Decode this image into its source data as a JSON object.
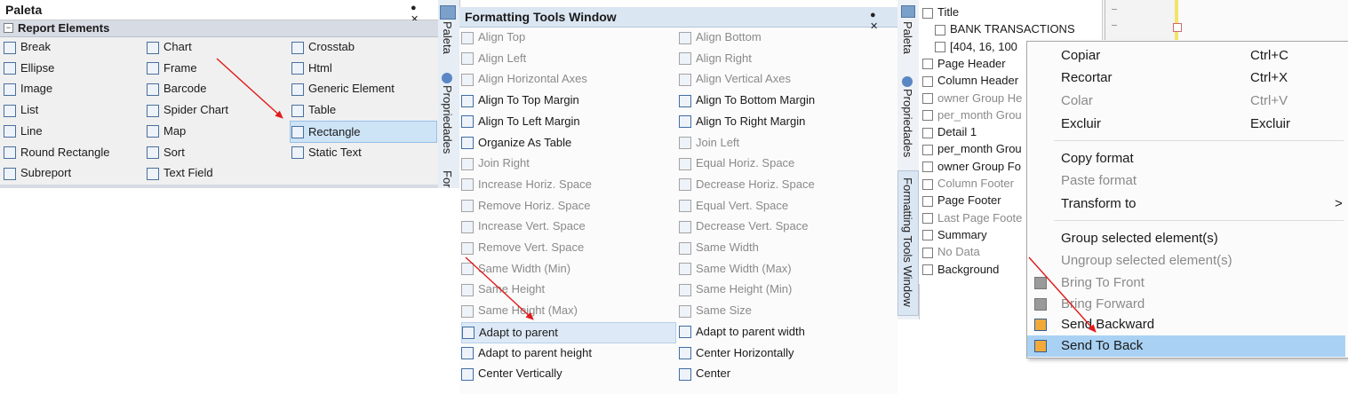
{
  "palette": {
    "title": "Paleta",
    "category": "Report Elements",
    "col1": [
      {
        "label": "Break",
        "icon": "break-icon"
      },
      {
        "label": "Ellipse",
        "icon": "ellipse-icon"
      },
      {
        "label": "Image",
        "icon": "image-icon"
      },
      {
        "label": "List",
        "icon": "list-icon"
      },
      {
        "label": "Line",
        "icon": "line-icon"
      },
      {
        "label": "Round Rectangle",
        "icon": "round-rectangle-icon"
      },
      {
        "label": "Subreport",
        "icon": "subreport-icon"
      }
    ],
    "col2": [
      {
        "label": "Chart",
        "icon": "chart-icon"
      },
      {
        "label": "Frame",
        "icon": "frame-icon"
      },
      {
        "label": "Barcode",
        "icon": "barcode-icon"
      },
      {
        "label": "Spider Chart",
        "icon": "spider-chart-icon"
      },
      {
        "label": "Map",
        "icon": "map-pin-icon"
      },
      {
        "label": "Sort",
        "icon": "sort-icon"
      },
      {
        "label": "Text Field",
        "icon": "text-field-icon"
      }
    ],
    "col3": [
      {
        "label": "Crosstab",
        "icon": "crosstab-icon"
      },
      {
        "label": "Html",
        "icon": "html-icon"
      },
      {
        "label": "Generic Element",
        "icon": "generic-element-icon"
      },
      {
        "label": "Table",
        "icon": "table-icon"
      },
      {
        "label": "Rectangle",
        "icon": "rectangle-icon",
        "selected": true
      },
      {
        "label": "Static Text",
        "icon": "static-text-icon"
      }
    ]
  },
  "side_tabs_1": {
    "paleta": "Paleta",
    "propriedades": "Propriedades",
    "formatting": "For"
  },
  "side_tabs_2": {
    "paleta": "Paleta",
    "propriedades": "Propriedades",
    "formatting": "Formatting Tools Window"
  },
  "formatting": {
    "title": "Formatting Tools Window",
    "left": [
      {
        "label": "Align Top",
        "enabled": false
      },
      {
        "label": "Align Left",
        "enabled": false
      },
      {
        "label": "Align Horizontal Axes",
        "enabled": false
      },
      {
        "label": "Align To Top Margin",
        "enabled": true
      },
      {
        "label": "Align To Left Margin",
        "enabled": true
      },
      {
        "label": "Organize As Table",
        "enabled": true
      },
      {
        "label": "Join Right",
        "enabled": false
      },
      {
        "label": "Increase Horiz. Space",
        "enabled": false
      },
      {
        "label": "Remove Horiz. Space",
        "enabled": false
      },
      {
        "label": "Increase Vert. Space",
        "enabled": false
      },
      {
        "label": "Remove Vert. Space",
        "enabled": false
      },
      {
        "label": "Same Width (Min)",
        "enabled": false
      },
      {
        "label": "Same Height",
        "enabled": false
      },
      {
        "label": "Same Height (Max)",
        "enabled": false
      },
      {
        "label": "Adapt to parent",
        "enabled": true,
        "selected": true
      },
      {
        "label": "Adapt to parent height",
        "enabled": true
      },
      {
        "label": "Center Vertically",
        "enabled": true
      }
    ],
    "right": [
      {
        "label": "Align Bottom",
        "enabled": false
      },
      {
        "label": "Align Right",
        "enabled": false
      },
      {
        "label": "Align Vertical Axes",
        "enabled": false
      },
      {
        "label": "Align To Bottom Margin",
        "enabled": true
      },
      {
        "label": "Align To Right Margin",
        "enabled": true
      },
      {
        "label": "Join Left",
        "enabled": false
      },
      {
        "label": "Equal Horiz. Space",
        "enabled": false
      },
      {
        "label": "Decrease Horiz. Space",
        "enabled": false
      },
      {
        "label": "Equal Vert. Space",
        "enabled": false
      },
      {
        "label": "Decrease Vert. Space",
        "enabled": false
      },
      {
        "label": "Same Width",
        "enabled": false
      },
      {
        "label": "Same Width (Max)",
        "enabled": false
      },
      {
        "label": "Same Height (Min)",
        "enabled": false
      },
      {
        "label": "Same Size",
        "enabled": false
      },
      {
        "label": "Adapt to parent width",
        "enabled": true
      },
      {
        "label": "Center Horizontally",
        "enabled": true
      },
      {
        "label": "Center",
        "enabled": true
      }
    ]
  },
  "tree": {
    "items": [
      {
        "label": "Title",
        "enabled": true,
        "indent": 0
      },
      {
        "label": "BANK TRANSACTIONS",
        "enabled": true,
        "indent": 1,
        "prefix": "label"
      },
      {
        "label": "[404, 16, 100",
        "enabled": true,
        "indent": 1
      },
      {
        "label": "Page Header",
        "enabled": true,
        "indent": 0
      },
      {
        "label": "Column Header",
        "enabled": true,
        "indent": 0
      },
      {
        "label": "owner Group He",
        "enabled": false,
        "indent": 0
      },
      {
        "label": "per_month Grou",
        "enabled": false,
        "indent": 0
      },
      {
        "label": "Detail 1",
        "enabled": true,
        "indent": 0
      },
      {
        "label": "per_month Grou",
        "enabled": true,
        "indent": 0
      },
      {
        "label": "owner Group Fo",
        "enabled": true,
        "indent": 0
      },
      {
        "label": "Column Footer",
        "enabled": false,
        "indent": 0
      },
      {
        "label": "Page Footer",
        "enabled": true,
        "indent": 0
      },
      {
        "label": "Last Page Foote",
        "enabled": false,
        "indent": 0
      },
      {
        "label": "Summary",
        "enabled": true,
        "indent": 0
      },
      {
        "label": "No Data",
        "enabled": false,
        "indent": 0
      },
      {
        "label": "Background",
        "enabled": true,
        "indent": 0
      }
    ]
  },
  "context_menu": {
    "items": [
      {
        "label": "Copiar",
        "shortcut": "Ctrl+C",
        "enabled": true
      },
      {
        "label": "Recortar",
        "shortcut": "Ctrl+X",
        "enabled": true
      },
      {
        "label": "Colar",
        "shortcut": "Ctrl+V",
        "enabled": false
      },
      {
        "label": "Excluir",
        "shortcut": "Excluir",
        "enabled": true
      },
      {
        "label": "Copy format",
        "enabled": true
      },
      {
        "label": "Paste format",
        "enabled": false
      },
      {
        "label": "Transform to",
        "enabled": true,
        "submenu": ">"
      },
      {
        "label": "Group selected element(s)",
        "enabled": true
      },
      {
        "label": "Ungroup selected element(s)",
        "enabled": false
      },
      {
        "label": "Bring To Front",
        "enabled": false
      },
      {
        "label": "Bring Forward",
        "enabled": false
      },
      {
        "label": "Send Backward",
        "enabled": true
      },
      {
        "label": "Send To Back",
        "enabled": true,
        "selected": true
      }
    ]
  },
  "colors": {
    "selection": "#cde3f6",
    "menu_selection": "#a9d1f3",
    "arrow": "#e21a1a",
    "disabled_text": "#8a8a8a"
  }
}
